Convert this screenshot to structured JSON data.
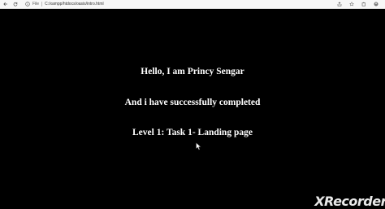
{
  "browser": {
    "address_label": "File",
    "url": "C:/xampp/htdocs/oasis/intro.html"
  },
  "page": {
    "line1": "Hello, I am Princy Sengar",
    "line2": "And i have successfully completed",
    "line3": "Level 1: Task 1- Landing page"
  },
  "watermark": "XRecorder"
}
